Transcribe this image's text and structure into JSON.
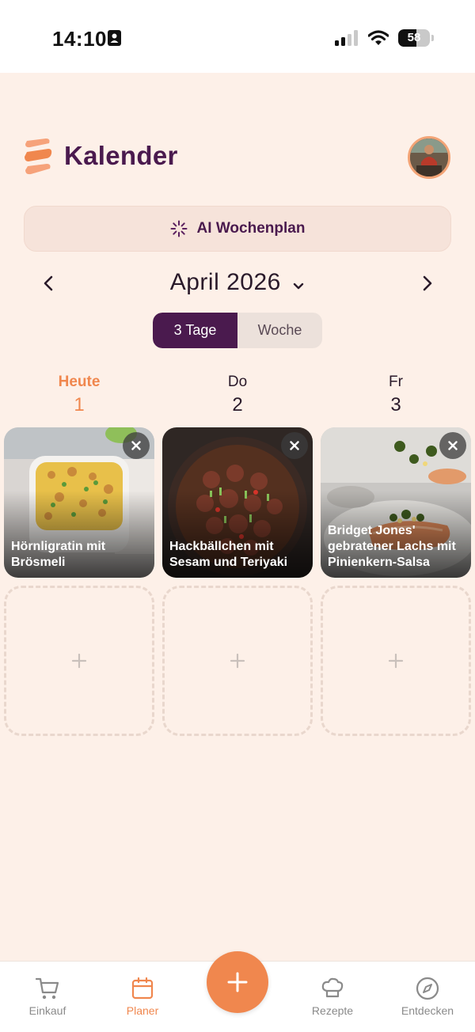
{
  "status_bar": {
    "time": "14:10",
    "battery": "58",
    "battery_level": 0.58
  },
  "header": {
    "title": "Kalender"
  },
  "ai_plan": {
    "label": "AI Wochenplan"
  },
  "calendar": {
    "month": "April 2026",
    "view_options": [
      "3 Tage",
      "Woche"
    ],
    "selected_view": "3 Tage"
  },
  "days": [
    {
      "name": "Heute",
      "number": "1",
      "is_today": true
    },
    {
      "name": "Do",
      "number": "2",
      "is_today": false
    },
    {
      "name": "Fr",
      "number": "3",
      "is_today": false
    }
  ],
  "meals": [
    {
      "title": "Hörnligratin mit Brösmeli"
    },
    {
      "title": "Hackbällchen mit Sesam und Teriyaki"
    },
    {
      "title": "Bridget Jones' gebratener Lachs mit Pinienkern-Salsa"
    }
  ],
  "add_slot_symbol": "+",
  "bottom_nav": {
    "items": [
      {
        "label": "Einkauf",
        "icon": "cart-icon"
      },
      {
        "label": "Planer",
        "icon": "calendar-icon",
        "active": true
      },
      {
        "label": "Rezepte",
        "icon": "chef-hat-icon"
      },
      {
        "label": "Entdecken",
        "icon": "compass-icon"
      }
    ],
    "fab_symbol": "+"
  },
  "colors": {
    "accent": "#f0874e",
    "brand": "#4a1a4e",
    "background": "#fdf0e8"
  }
}
